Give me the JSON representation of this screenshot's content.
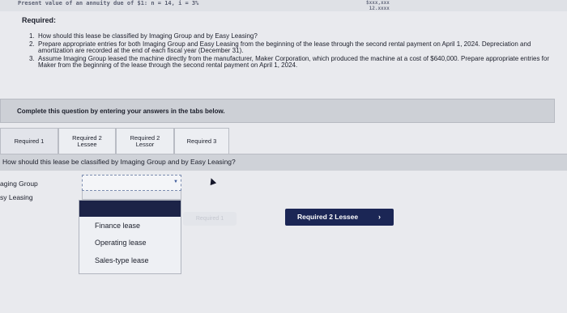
{
  "header": {
    "pv_text": "Present value of an annuity due of $1: n = 14, i = 3%",
    "pv_values": [
      "$xxx,xxx",
      "12.xxxx"
    ]
  },
  "required_heading": "Required:",
  "requirements": [
    {
      "num": "1.",
      "text": "How should this lease be classified by Imaging Group and by Easy Leasing?"
    },
    {
      "num": "2.",
      "text": "Prepare appropriate entries for both Imaging Group and Easy Leasing from the beginning of the lease through the second rental payment on April 1, 2024. Depreciation and amortization are recorded at the end of each fiscal year (December 31)."
    },
    {
      "num": "3.",
      "text": "Assume Imaging Group leased the machine directly from the manufacturer, Maker Corporation, which produced the machine at a cost of $640,000. Prepare appropriate entries for Maker from the beginning of the lease through the second rental payment on April 1, 2024."
    }
  ],
  "instruction": "Complete this question by entering your answers in the tabs below.",
  "tabs": [
    {
      "line1": "Required 1",
      "line2": ""
    },
    {
      "line1": "Required 2",
      "line2": "Lessee"
    },
    {
      "line1": "Required 2",
      "line2": "Lessor"
    },
    {
      "line1": "Required 3",
      "line2": ""
    }
  ],
  "question": "How should this lease be classified by Imaging Group and by Easy Leasing?",
  "answer_rows": [
    "aging Group",
    "sy Leasing"
  ],
  "dropdown": {
    "selected_value": "",
    "options": [
      "Finance lease",
      "Operating lease",
      "Sales-type lease"
    ]
  },
  "buttons": {
    "prev_label": "Required 1",
    "next_label": "Required 2 Lessee",
    "next_chevron": "›"
  }
}
